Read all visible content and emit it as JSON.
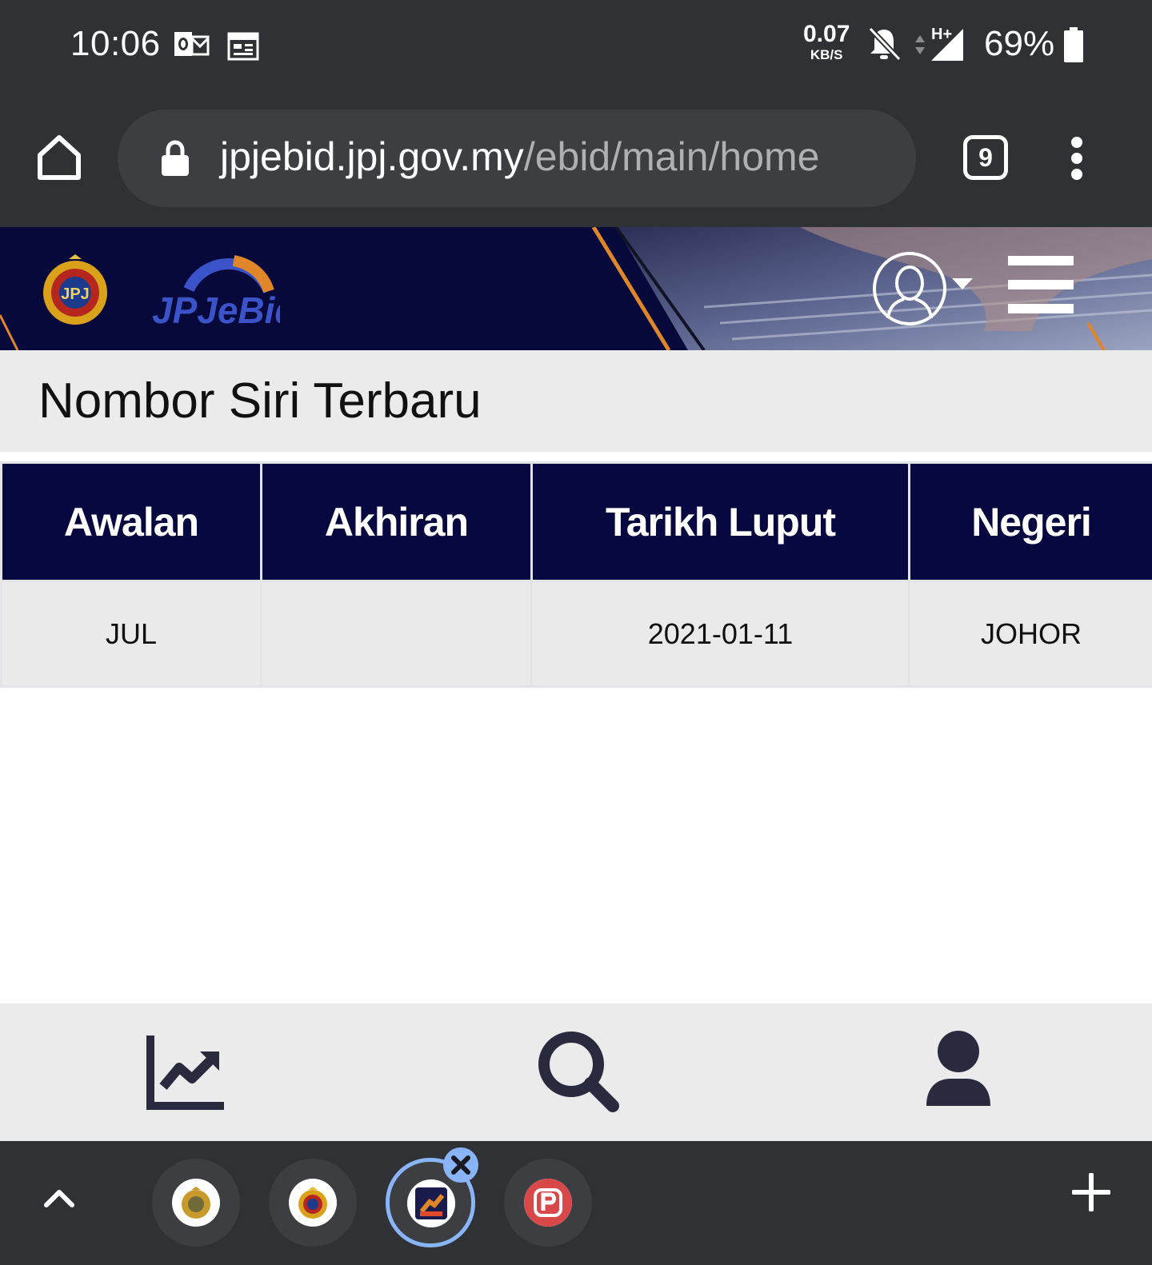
{
  "status_bar": {
    "time": "10:06",
    "net_speed_value": "0.07",
    "net_speed_unit": "KB/S",
    "network_type": "H+",
    "battery_percent": "69%",
    "icons": [
      "outlook-notification-icon",
      "calendar-notification-icon",
      "bell-muted-icon",
      "data-arrows-icon",
      "signal-icon",
      "battery-icon"
    ]
  },
  "browser": {
    "url_host": "jpjebid.jpj.gov.my",
    "url_path": "/ebid/main/home",
    "tab_count": "9",
    "icons": [
      "home-icon",
      "lock-icon",
      "more-vert-icon"
    ]
  },
  "site": {
    "logo_text": "JPJeBid",
    "emblem_text": "JPJ",
    "header_colors": {
      "navy": "#07093a",
      "accent": "#e0862a"
    }
  },
  "page": {
    "title": "Nombor Siri Terbaru"
  },
  "table": {
    "headers": [
      "Awalan",
      "Akhiran",
      "Tarikh Luput",
      "Negeri"
    ],
    "rows": [
      [
        "JUL",
        "",
        "2021-01-11",
        "JOHOR"
      ]
    ],
    "header_color": "#07083f"
  },
  "app_nav": {
    "items": [
      "trend-chart-icon",
      "search-icon",
      "user-icon"
    ]
  },
  "tab_strip": {
    "tabs": [
      "jpj-emblem-favicon",
      "jpj-emblem-favicon-2",
      "jpjebid-favicon",
      "p-favicon"
    ],
    "active_index": 2,
    "icons": [
      "chevron-up-icon",
      "close-icon",
      "plus-icon"
    ]
  }
}
